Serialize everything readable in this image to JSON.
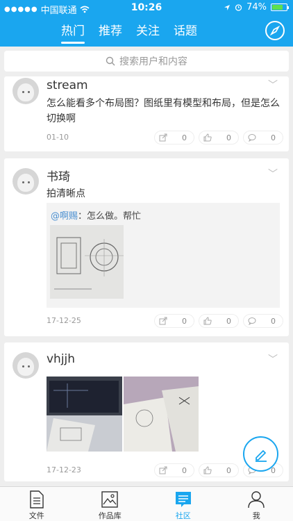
{
  "status": {
    "carrier": "中国联通",
    "time": "10:26",
    "battery": "74%",
    "battery_level": 0.74
  },
  "tabs": [
    {
      "label": "热门",
      "active": true
    },
    {
      "label": "推荐",
      "active": false
    },
    {
      "label": "关注",
      "active": false
    },
    {
      "label": "话题",
      "active": false
    }
  ],
  "search": {
    "placeholder": "搜索用户和内容"
  },
  "posts": [
    {
      "user": "stream",
      "content": "怎么能看多个布局图？图纸里有模型和布局，但是怎么切换啊",
      "date": "01-10",
      "share": "0",
      "like": "0",
      "comment": "0"
    },
    {
      "user": "书琦",
      "content": "拍清晰点",
      "quote_mention": "@啊赐",
      "quote_text": "：怎么做。帮忙",
      "date": "17-12-25",
      "share": "0",
      "like": "0",
      "comment": "0"
    },
    {
      "user": "vhjjh",
      "date": "17-12-23",
      "share": "0",
      "like": "0",
      "comment": "0"
    }
  ],
  "tabbar": [
    {
      "label": "文件",
      "icon": "document-icon",
      "active": false
    },
    {
      "label": "作品库",
      "icon": "gallery-icon",
      "active": false
    },
    {
      "label": "社区",
      "icon": "community-icon",
      "active": true
    },
    {
      "label": "我",
      "icon": "profile-icon",
      "active": false
    }
  ],
  "colors": {
    "accent": "#1aa6ef",
    "mention": "#4a8fd0"
  }
}
